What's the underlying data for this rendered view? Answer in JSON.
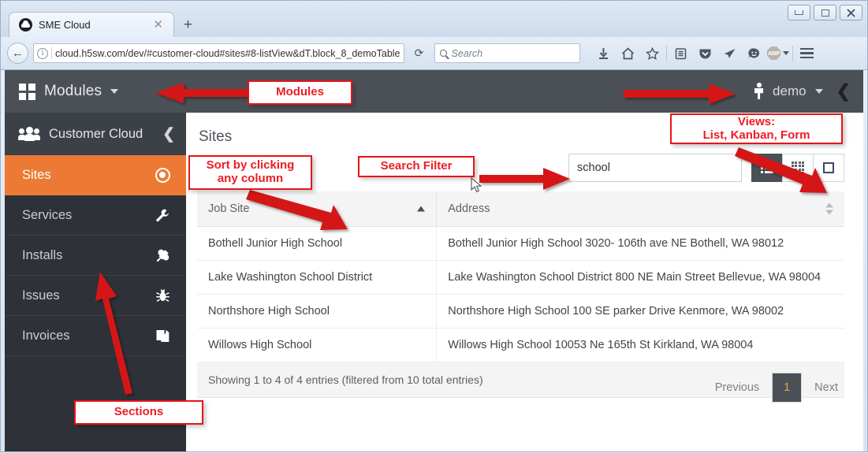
{
  "browser": {
    "tab_title": "SME Cloud",
    "tab_close": "✕",
    "new_tab": "+",
    "url": "cloud.h5sw.com/dev/#customer-cloud#sites#8-listView&dT.block_8_demoTable",
    "search_placeholder": "Search",
    "reload_glyph": "⟳",
    "back_glyph": "←",
    "info_glyph": "i",
    "abp_label": "ABP",
    "window": {
      "minimize": "—",
      "maximize": "❐",
      "close": "✕"
    }
  },
  "app": {
    "topbar": {
      "modules_label": "Modules",
      "user_name": "demo",
      "collapse_glyph": "❮"
    },
    "sidebar": {
      "header_label": "Customer Cloud",
      "header_chevron": "❮",
      "items": [
        {
          "label": "Sites",
          "icon": "target-icon",
          "active": true
        },
        {
          "label": "Services",
          "icon": "wrench-icon",
          "active": false
        },
        {
          "label": "Installs",
          "icon": "plug-icon",
          "active": false
        },
        {
          "label": "Issues",
          "icon": "bug-icon",
          "active": false
        },
        {
          "label": "Invoices",
          "icon": "copy-icon",
          "active": false
        }
      ]
    },
    "main": {
      "page_title": "Sites",
      "search": {
        "value": "school",
        "placeholder": ""
      },
      "views": [
        {
          "name": "list-view",
          "label": "List",
          "active": true
        },
        {
          "name": "kanban-view",
          "label": "Kanban",
          "active": false
        },
        {
          "name": "form-view",
          "label": "Form",
          "active": false
        }
      ],
      "table": {
        "columns": [
          {
            "label": "Job Site",
            "sort": "asc"
          },
          {
            "label": "Address",
            "sort": "none"
          }
        ],
        "rows": [
          [
            "Bothell Junior High School",
            "Bothell Junior High School 3020- 106th ave NE Bothell, WA 98012"
          ],
          [
            "Lake Washington School District",
            "Lake Washington School District 800 NE Main Street Bellevue, WA 98004"
          ],
          [
            "Northshore High School",
            "Northshore High School 100 SE parker Drive Kenmore, WA 98002"
          ],
          [
            "Willows High School",
            "Willows High School 10053 Ne 165th St Kirkland, WA 98004"
          ]
        ],
        "info": "Showing 1 to 4 of 4 entries (filtered from 10 total entries)"
      },
      "pagination": {
        "previous": "Previous",
        "current": "1",
        "next": "Next"
      }
    }
  },
  "annotations": {
    "modules": "Modules",
    "views_line1": "Views:",
    "views_line2": "List, Kanban, Form",
    "sort_line1": "Sort by clicking",
    "sort_line2": "any column",
    "search_filter": "Search Filter",
    "sections": "Sections"
  },
  "colors": {
    "accent_orange": "#ec7a34",
    "dark_bar": "#4b5056",
    "sidebar_dark": "#2e3238",
    "annotation_red": "#ee1c24",
    "pager_active_text": "#e0a44f"
  }
}
